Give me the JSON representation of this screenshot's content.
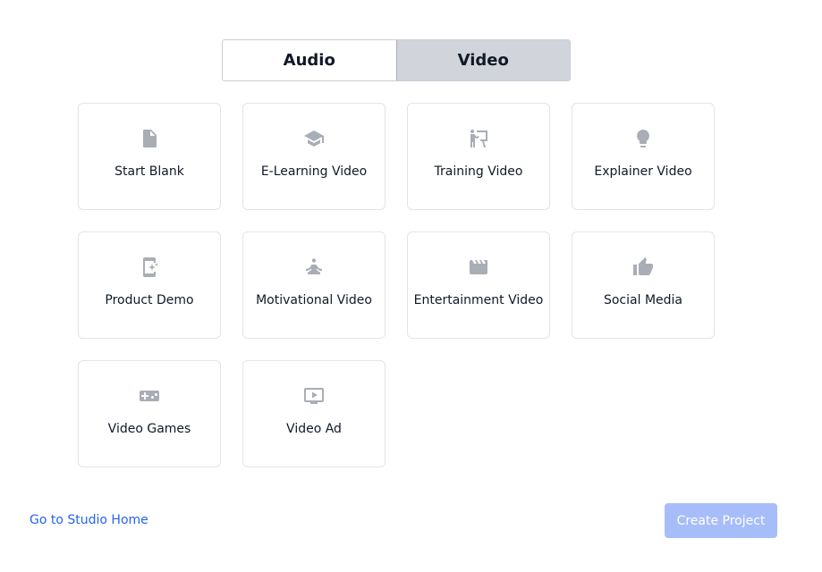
{
  "mode_toggle": {
    "audio_label": "Audio",
    "video_label": "Video",
    "selected": "Video"
  },
  "templates": [
    {
      "label": "Start Blank",
      "icon": "document-icon"
    },
    {
      "label": "E-Learning Video",
      "icon": "graduation-cap-icon"
    },
    {
      "label": "Training Video",
      "icon": "presenter-board-icon"
    },
    {
      "label": "Explainer Video",
      "icon": "lightbulb-icon"
    },
    {
      "label": "Product Demo",
      "icon": "phone-sparkle-icon"
    },
    {
      "label": "Motivational Video",
      "icon": "meditation-icon"
    },
    {
      "label": "Entertainment Video",
      "icon": "clapperboard-icon"
    },
    {
      "label": "Social Media",
      "icon": "thumbs-up-icon"
    },
    {
      "label": "Video Games",
      "icon": "gamepad-icon"
    },
    {
      "label": "Video Ad",
      "icon": "tv-play-icon"
    }
  ],
  "footer": {
    "home_link": "Go to Studio Home",
    "create_button": "Create Project",
    "create_button_disabled": true
  },
  "colors": {
    "accent_link": "#2563eb",
    "create_button_disabled_bg": "#a7bdfa",
    "icon_gray": "#a9adb5",
    "toggle_active_bg": "#d1d5db"
  }
}
